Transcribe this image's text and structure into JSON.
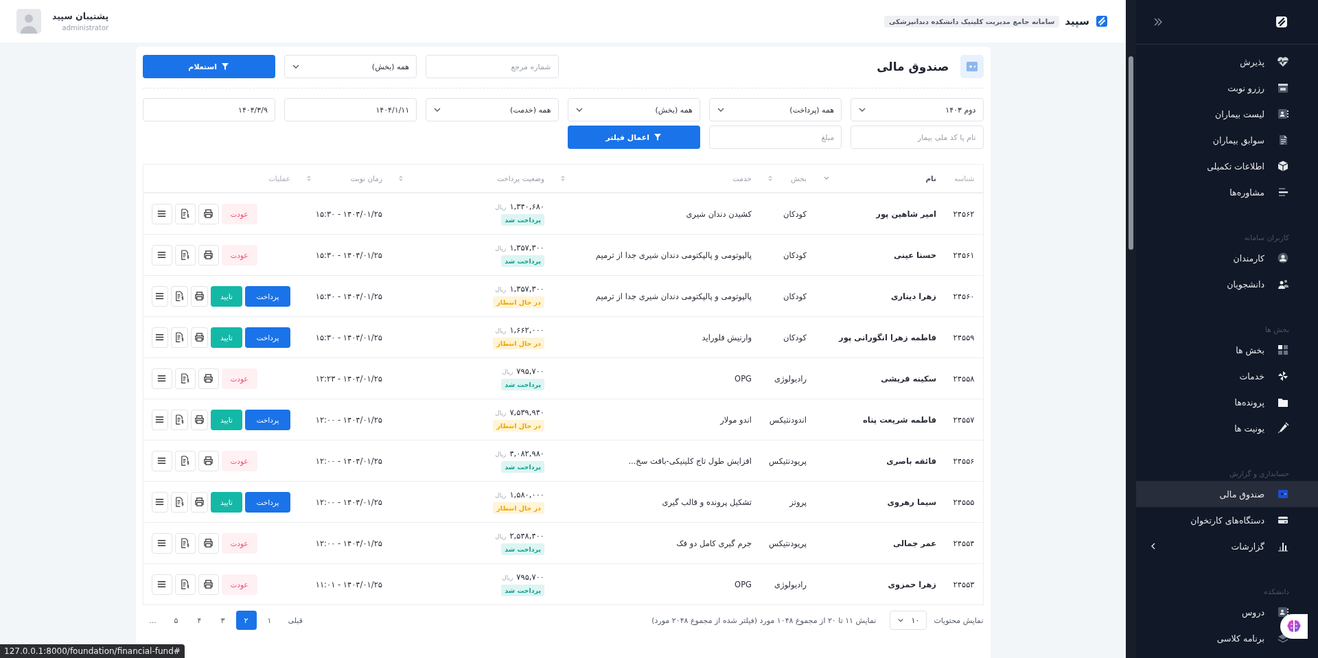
{
  "header": {
    "brand": "سپید",
    "tagline": "سامانه جامع مدیریت کلینیک دانشکده دندانپزشکی",
    "user_name": "پشتیبان سپید",
    "user_role": "administrator"
  },
  "sidebar": {
    "sections": [
      {
        "items": [
          {
            "label": "پذیرش",
            "selected": false,
            "has_submenu": false
          },
          {
            "label": "رزرو نوبت",
            "selected": false,
            "has_submenu": false
          },
          {
            "label": "لیست بیماران",
            "selected": false,
            "has_submenu": false
          },
          {
            "label": "سوابق بیماران",
            "selected": false,
            "has_submenu": false
          },
          {
            "label": "اطلاعات تکمیلی",
            "selected": false,
            "has_submenu": false
          },
          {
            "label": "مشاوره‌ها",
            "selected": false,
            "has_submenu": false
          }
        ]
      },
      {
        "title": "کاربران سامانه",
        "items": [
          {
            "label": "کارمندان",
            "selected": false,
            "has_submenu": false
          },
          {
            "label": "دانشجویان",
            "selected": false,
            "has_submenu": false
          }
        ]
      },
      {
        "title": "بخش ها",
        "items": [
          {
            "label": "بخش ها",
            "selected": false,
            "has_submenu": false
          },
          {
            "label": "خدمات",
            "selected": false,
            "has_submenu": false
          },
          {
            "label": "پرونده‌ها",
            "selected": false,
            "has_submenu": false
          },
          {
            "label": "یونیت ها",
            "selected": false,
            "has_submenu": false
          }
        ]
      },
      {
        "title": "حسابداری و گزارش",
        "items": [
          {
            "label": "صندوق مالی",
            "selected": true,
            "has_submenu": false
          },
          {
            "label": "دستگاه‌های کارتخوان",
            "selected": false,
            "has_submenu": false
          },
          {
            "label": "گزارشات",
            "selected": false,
            "has_submenu": true
          }
        ]
      },
      {
        "title": "دانشکده",
        "items": [
          {
            "label": "دروس",
            "selected": false,
            "has_submenu": false
          },
          {
            "label": "برنامه کلاسی",
            "selected": false,
            "has_submenu": false
          }
        ]
      }
    ]
  },
  "page": {
    "title": "صندوق مالی",
    "inquiry": [
      {
        "kind": "input",
        "placeholder": "شماره مرجع"
      },
      {
        "kind": "select",
        "value": "همه (بخش)"
      },
      {
        "kind": "button",
        "label": "استعلام"
      }
    ],
    "filters": [
      {
        "kind": "select",
        "value": "دوم ۱۴۰۳"
      },
      {
        "kind": "select",
        "value": "همه (پرداخت)"
      },
      {
        "kind": "select",
        "value": "همه (بخش)"
      },
      {
        "kind": "select",
        "value": "همه (خدمت)"
      },
      {
        "kind": "date",
        "value": "۱۴۰۴/۱/۱۱"
      },
      {
        "kind": "date",
        "value": "۱۴۰۴/۳/۹"
      },
      {
        "kind": "input",
        "placeholder": "نام یا کد ملی بیمار"
      },
      {
        "kind": "input",
        "placeholder": "مبلغ"
      },
      {
        "kind": "button",
        "label": "اعمال فیلتر"
      }
    ]
  },
  "table": {
    "columns": [
      {
        "label": "شناسه",
        "sortable": false,
        "sorted": false
      },
      {
        "label": "نام",
        "sortable": true,
        "sorted": true
      },
      {
        "label": "بخش",
        "sortable": true,
        "sorted": false
      },
      {
        "label": "خدمت",
        "sortable": true,
        "sorted": false
      },
      {
        "label": "وضعیت پرداخت",
        "sortable": true,
        "sorted": false
      },
      {
        "label": "زمان نوبت",
        "sortable": true,
        "sorted": false
      },
      {
        "label": "عملیات",
        "sortable": false,
        "sorted": false
      }
    ],
    "rows": [
      {
        "id": "۲۴۵۶۲",
        "name": "امیر شاهین پور",
        "department": "کودکان",
        "service": "کشیدن دندان شیری",
        "amount": "۱,۳۴۰,۶۸۰",
        "currency": "ریال",
        "status": {
          "label": "پرداخت شد",
          "kind": "paid"
        },
        "time": "۱۴۰۴/۰۱/۲۵ - ۱۵:۳۰",
        "actions": [
          {
            "kind": "refund",
            "label": "عودت"
          }
        ]
      },
      {
        "id": "۲۴۵۶۱",
        "name": "حسنا عینی",
        "department": "کودکان",
        "service": "پالپوتومی و پالپکتومی دندان شیری جدا از ترمیم",
        "amount": "۱,۳۵۷,۳۰۰",
        "currency": "ریال",
        "status": {
          "label": "پرداخت شد",
          "kind": "paid"
        },
        "time": "۱۴۰۴/۰۱/۲۵ - ۱۵:۳۰",
        "actions": [
          {
            "kind": "refund",
            "label": "عودت"
          }
        ]
      },
      {
        "id": "۲۴۵۶۰",
        "name": "زهرا دیناری",
        "department": "کودکان",
        "service": "پالپوتومی و پالپکتومی دندان شیری جدا از ترمیم",
        "amount": "۱,۳۵۷,۳۰۰",
        "currency": "ریال",
        "status": {
          "label": "در حال انتظار",
          "kind": "pending"
        },
        "time": "۱۴۰۴/۰۱/۲۵ - ۱۵:۳۰",
        "actions": [
          {
            "kind": "pay",
            "label": "پرداخت"
          },
          {
            "kind": "confirm",
            "label": "تایید"
          }
        ]
      },
      {
        "id": "۲۴۵۵۹",
        "name": "فاطمه زهرا انگورانی پور",
        "department": "کودکان",
        "service": "وارنیش فلوراید",
        "amount": "۱,۶۶۲,۰۰۰",
        "currency": "ریال",
        "status": {
          "label": "در حال انتظار",
          "kind": "pending"
        },
        "time": "۱۴۰۴/۰۱/۲۵ - ۱۵:۳۰",
        "actions": [
          {
            "kind": "pay",
            "label": "پرداخت"
          },
          {
            "kind": "confirm",
            "label": "تایید"
          }
        ]
      },
      {
        "id": "۲۴۵۵۸",
        "name": "سکینه قریشی",
        "department": "رادیولوژی",
        "service": "OPG",
        "amount": "۷۹۵,۷۰۰",
        "currency": "ریال",
        "status": {
          "label": "پرداخت شد",
          "kind": "paid"
        },
        "time": "۱۴۰۴/۰۱/۲۵ - ۱۲:۲۳",
        "actions": [
          {
            "kind": "refund",
            "label": "عودت"
          }
        ]
      },
      {
        "id": "۲۴۵۵۷",
        "name": "فاطمه شریعت پناه",
        "department": "اندودنتیکس",
        "service": "اندو مولار",
        "amount": "۷,۵۳۹,۹۴۰",
        "currency": "ریال",
        "status": {
          "label": "در حال انتظار",
          "kind": "pending"
        },
        "time": "۱۴۰۴/۰۱/۲۵ - ۱۲:۰۰",
        "actions": [
          {
            "kind": "pay",
            "label": "پرداخت"
          },
          {
            "kind": "confirm",
            "label": "تایید"
          }
        ]
      },
      {
        "id": "۲۴۵۵۶",
        "name": "فائقه باصری",
        "department": "پریودنتیکس",
        "service": "افزایش طول تاج کلینیکی-بافت سخ...",
        "amount": "۴,۰۸۲,۹۸۰",
        "currency": "ریال",
        "status": {
          "label": "پرداخت شد",
          "kind": "paid"
        },
        "time": "۱۴۰۴/۰۱/۲۵ - ۱۲:۰۰",
        "actions": [
          {
            "kind": "refund",
            "label": "عودت"
          }
        ]
      },
      {
        "id": "۲۴۵۵۵",
        "name": "سیما رهروی",
        "department": "پروتز",
        "service": "تشکیل پرونده و قالب گیری",
        "amount": "۱,۵۸۰,۰۰۰",
        "currency": "ریال",
        "status": {
          "label": "در حال انتظار",
          "kind": "pending"
        },
        "time": "۱۴۰۴/۰۱/۲۵ - ۱۲:۰۰",
        "actions": [
          {
            "kind": "pay",
            "label": "پرداخت"
          },
          {
            "kind": "confirm",
            "label": "تایید"
          }
        ]
      },
      {
        "id": "۲۴۵۵۴",
        "name": "عمر جمالی",
        "department": "پریودنتیکس",
        "service": "جرم گیری کامل دو فک",
        "amount": "۲,۵۴۸,۴۰۰",
        "currency": "ریال",
        "status": {
          "label": "پرداخت شد",
          "kind": "paid"
        },
        "time": "۱۴۰۴/۰۱/۲۵ - ۱۲:۰۰",
        "actions": [
          {
            "kind": "refund",
            "label": "عودت"
          }
        ]
      },
      {
        "id": "۲۴۵۵۳",
        "name": "زهرا حمزوی",
        "department": "رادیولوژی",
        "service": "OPG",
        "amount": "۷۹۵,۷۰۰",
        "currency": "ریال",
        "status": {
          "label": "پرداخت شد",
          "kind": "paid"
        },
        "time": "۱۴۰۴/۰۱/۲۵ - ۱۱:۰۱",
        "actions": [
          {
            "kind": "refund",
            "label": "عودت"
          }
        ]
      }
    ]
  },
  "footer": {
    "page_size_label": "نمایش محتویات",
    "page_size": "۱۰",
    "info": "نمایش ۱۱ تا ۲۰ از مجموع ۱۰۴۸ مورد (فیلتر شده از مجموع ۲۰۴۸ مورد)",
    "pages": [
      {
        "label": "قبلی",
        "selected": false
      },
      {
        "label": "۱",
        "selected": false
      },
      {
        "label": "۲",
        "selected": true
      },
      {
        "label": "۳",
        "selected": false
      },
      {
        "label": "۴",
        "selected": false
      },
      {
        "label": "۵",
        "selected": false
      },
      {
        "label": "...",
        "selected": false
      }
    ]
  },
  "status_url": "127.0.0.1:8000/foundation/financial-fund#"
}
